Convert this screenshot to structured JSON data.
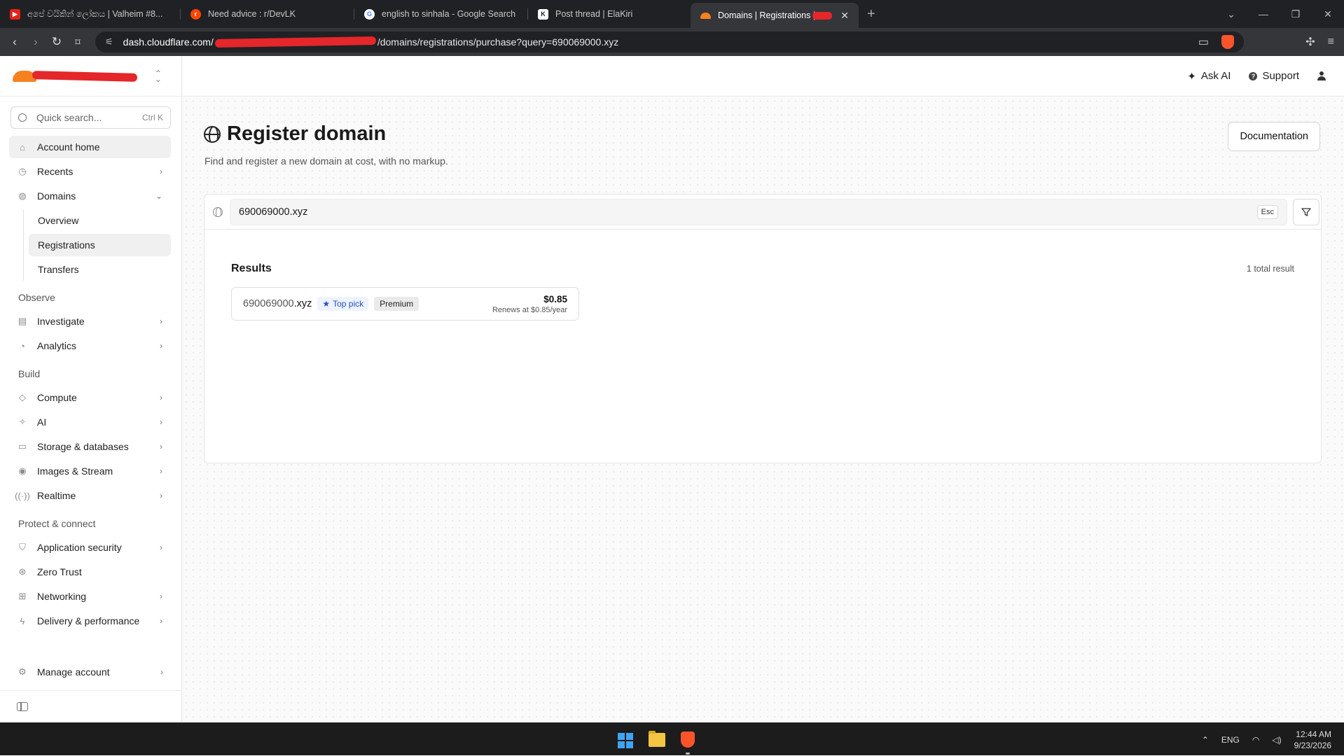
{
  "browser": {
    "tabs": [
      {
        "title": "අපේ වයිකින් ලෝකය | Valheim #8..."
      },
      {
        "title": "Need advice : r/DevLK"
      },
      {
        "title": "english to sinhala - Google Search"
      },
      {
        "title": "Post thread | ElaKiri"
      },
      {
        "title": "Domains | Registrations |"
      }
    ],
    "url": {
      "host": "dash.cloudflare.com/",
      "path": "/domains/registrations/purchase?query=690069000.xyz"
    }
  },
  "sidebar": {
    "search_placeholder": "Quick search...",
    "search_shortcut": "Ctrl K",
    "items": [
      {
        "label": "Account home"
      },
      {
        "label": "Recents"
      },
      {
        "label": "Domains"
      }
    ],
    "domain_sub": [
      {
        "label": "Overview"
      },
      {
        "label": "Registrations"
      },
      {
        "label": "Transfers"
      }
    ],
    "observe": {
      "title": "Observe",
      "items": [
        {
          "label": "Investigate"
        },
        {
          "label": "Analytics"
        }
      ]
    },
    "build": {
      "title": "Build",
      "items": [
        {
          "label": "Compute"
        },
        {
          "label": "AI"
        },
        {
          "label": "Storage & databases"
        },
        {
          "label": "Images & Stream"
        },
        {
          "label": "Realtime"
        }
      ]
    },
    "protect": {
      "title": "Protect & connect",
      "items": [
        {
          "label": "Application security"
        },
        {
          "label": "Zero Trust"
        },
        {
          "label": "Networking"
        },
        {
          "label": "Delivery & performance"
        }
      ]
    },
    "manage": {
      "label": "Manage account"
    }
  },
  "header": {
    "ask_ai": "Ask AI",
    "support": "Support"
  },
  "page": {
    "title": "Register domain",
    "subtitle": "Find and register a new domain at cost, with no markup.",
    "doc_button": "Documentation",
    "query": "690069000.xyz",
    "esc_label": "Esc",
    "results_title": "Results",
    "total": "1 total result",
    "result": {
      "name": "690069000",
      "tld": ".xyz",
      "top_pick": "Top pick",
      "premium": "Premium",
      "price": "$0.85",
      "renew": "Renews at $0.85/year"
    }
  },
  "taskbar": {
    "lang": "ENG",
    "time": "12:44 AM",
    "date": "9/23/2026"
  },
  "colors": {
    "accent_orange": "#f6821f",
    "top_pick_blue": "#1f4fc2",
    "brave_orange": "#fb542b"
  }
}
